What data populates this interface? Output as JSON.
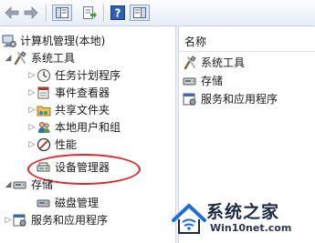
{
  "toolbar": {
    "buttons": [
      {
        "name": "back-button",
        "icon": "back-arrow-icon"
      },
      {
        "name": "forward-button",
        "icon": "forward-arrow-icon"
      },
      {
        "name": "show-tree-button",
        "icon": "console-tree-icon"
      },
      {
        "name": "export-list-button",
        "icon": "export-list-icon"
      },
      {
        "name": "help-button",
        "icon": "help-icon"
      },
      {
        "name": "action-pane-button",
        "icon": "action-pane-icon"
      }
    ]
  },
  "tree": {
    "root": "计算机管理(本地)",
    "system_tools": "系统工具",
    "task_scheduler": "任务计划程序",
    "event_viewer": "事件查看器",
    "shared_folders": "共享文件夹",
    "local_users": "本地用户和组",
    "performance": "性能",
    "device_manager": "设备管理器",
    "storage": "存储",
    "disk_management": "磁盘管理",
    "services_apps": "服务和应用程序"
  },
  "list": {
    "header": "名称",
    "items": [
      "系统工具",
      "存储",
      "服务和应用程序"
    ]
  },
  "watermark": {
    "title": "系统之家",
    "url": "Win10net.com"
  },
  "colors": {
    "highlight": "#e0262a",
    "toolbar_bg": "#e7edf6"
  }
}
